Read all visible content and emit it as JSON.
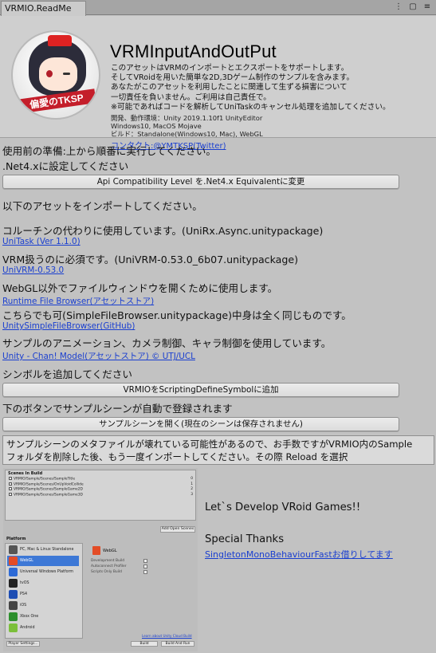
{
  "window": {
    "tab_title": "VRMIO.ReadMe",
    "icons": [
      "more-icon",
      "maximize-icon",
      "close-icon"
    ]
  },
  "header": {
    "logo_text": "偏愛のTKSP",
    "title": "VRMInputAndOutPut",
    "description": [
      "このアセットはVRMのインポートとエクスポートをサポートします。",
      "そしてVRoidを用いた簡単な2D,3Dゲーム制作のサンプルを含みます。",
      "あなたがこのアセットを利用したことに関連して生ずる損害について",
      "一切責任を負いません。ご利用は自己責任で。",
      "※可能であればコードを解析してUniTaskのキャンセル処理を追加してください。"
    ],
    "meta": [
      "開発、動作環境：Unity 2019.1.10f1 UnityEditor",
      "Windows10, MacOS Mojave",
      "ビルド：Standalone(Windows10, Mac), WebGL"
    ],
    "contact": "コンタクト:@YMTKSP(Twitter)"
  },
  "body": {
    "prep": "使用前の準備:上から順番に実行してください。",
    "net4": ".Net4.xに設定してください",
    "net4_button": "Api Compatibility Level を.Net4.x Equivalentに変更",
    "import_heading": "以下のアセットをインポートしてください。",
    "assets": [
      {
        "desc": "コルーチンの代わりに使用しています。(UniRx.Async.unitypackage)",
        "link": "UniTask (Ver 1.1.0)"
      },
      {
        "desc": "VRM扱うのに必須です。(UniVRM-0.53.0_6b07.unitypackage)",
        "link": "UniVRM-0.53.0"
      },
      {
        "desc": "WebGL以外でファイルウィンドウを開くために使用します。",
        "link": "Runtime File Browser(アセットストア)"
      },
      {
        "desc": "こちらでも可(SimpleFileBrowser.unitypackage)中身は全く同じものです。",
        "link": "UnitySimpleFileBrowser(GitHub)"
      },
      {
        "desc": "サンプルのアニメーション、カメラ制御、キャラ制御を使用しています。",
        "link": "Unity - Chan! Model(アセットストア) © UTJ/UCL"
      }
    ],
    "symbol_heading": "シンボルを追加してください",
    "symbol_button": "VRMIOをScriptingDefineSymbolに追加",
    "sample_heading": "下のボタンでサンプルシーンが自動で登録されます",
    "sample_button": "サンプルシーンを開く(現在のシーンは保存されません)",
    "help": [
      "サンプルシーンのメタファイルが壊れている可能性があるので、お手数ですがVRMIO内のSample",
      "フォルダを削除した後、もう一度インポートしてください。その際 Reload を選択"
    ]
  },
  "build_settings": {
    "scenes_header": "Scenes In Build",
    "scenes": [
      {
        "path": "VRMIO/Sample/Scenes/SampleTitle",
        "index": "0"
      },
      {
        "path": "VRMIO/Sample/Scenes/OnUpVoidCollide",
        "index": "1"
      },
      {
        "path": "VRMIO/Sample/Scenes/SampleGame2D",
        "index": "2"
      },
      {
        "path": "VRMIO/Sample/Scenes/SampleGame3D",
        "index": "3"
      }
    ],
    "add_open_scenes": "Add Open Scenes",
    "platform_label": "Platform",
    "platforms": [
      {
        "name": "PC, Mac & Linux Standalone",
        "color": "#555555"
      },
      {
        "name": "WebGL",
        "color": "#e34c26",
        "selected": true
      },
      {
        "name": "Universal Windows Platform",
        "color": "#2d6ad6"
      },
      {
        "name": "tvOS",
        "color": "#222222"
      },
      {
        "name": "PS4",
        "color": "#1d4db3"
      },
      {
        "name": "iOS",
        "color": "#444444"
      },
      {
        "name": "Xbox One",
        "color": "#2d8f2d"
      },
      {
        "name": "Android",
        "color": "#7bbf3a"
      }
    ],
    "selected_platform": "WebGL",
    "options": [
      "Development Build",
      "Autoconnect Profiler",
      "Scripts Only Build"
    ],
    "learn_more": "Learn about Unity Cloud Build",
    "player_settings": "Player Settings...",
    "build": "Build",
    "build_and_run": "Build And Run"
  },
  "right": {
    "develop": "Let`s Develop VRoid Games!!",
    "thanks": "Special Thanks",
    "thanks_link": "SingletonMonoBehaviourFastお借りしてます"
  }
}
